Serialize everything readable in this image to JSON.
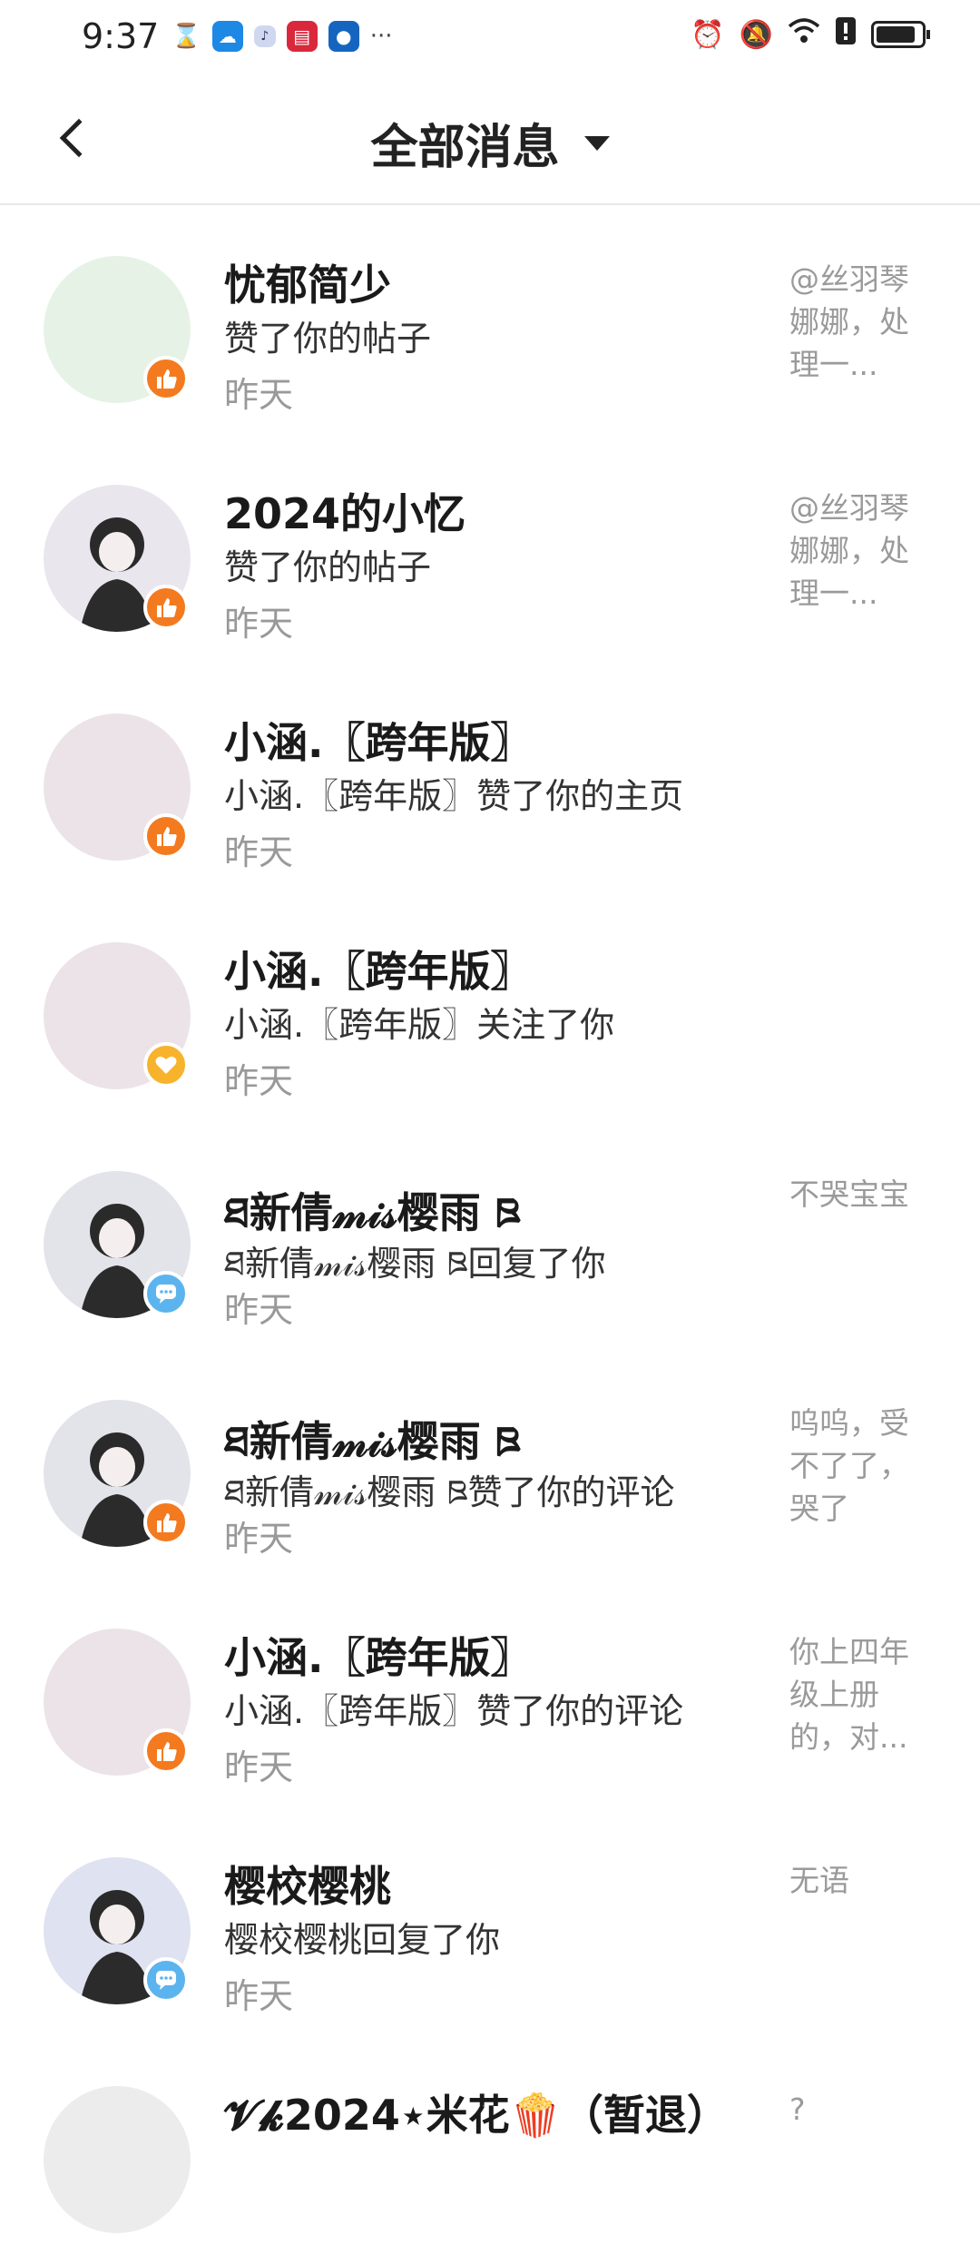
{
  "status_bar": {
    "time": "9:37",
    "dots": "···"
  },
  "header": {
    "title": "全部消息"
  },
  "messages": [
    {
      "name": "忧郁简少",
      "action": "赞了你的帖子",
      "time": "昨天",
      "preview": "@丝羽琴娜娜，处理一...",
      "badge": "like",
      "avatar_color": "#e6f2e6"
    },
    {
      "name": "2024的小忆",
      "action": "赞了你的帖子",
      "time": "昨天",
      "preview": "@丝羽琴娜娜，处理一...",
      "badge": "like",
      "avatar_color": "#e9e6ee"
    },
    {
      "name": "小涵.〖跨年版〗",
      "action": "小涵.〖跨年版〗赞了你的主页",
      "time": "昨天",
      "preview": "",
      "badge": "like",
      "avatar_color": "#ebe3e8"
    },
    {
      "name": "小涵.〖跨年版〗",
      "action": "小涵.〖跨年版〗关注了你",
      "time": "昨天",
      "preview": "",
      "badge": "follow",
      "avatar_color": "#ebe3e8"
    },
    {
      "name": "ཐ新倩𝓂𝒾𝓈樱雨 ཋ",
      "action": "ཐ新倩𝓂𝒾𝓈樱雨 ཋ回复了你",
      "time": "昨天",
      "preview": "不哭宝宝",
      "badge": "reply",
      "avatar_color": "#e3e3ea"
    },
    {
      "name": "ཐ新倩𝓂𝒾𝓈樱雨 ཋ",
      "action": "ཐ新倩𝓂𝒾𝓈樱雨 ཋ赞了你的评论",
      "time": "昨天",
      "preview": "呜呜，受不了了，哭了",
      "badge": "like",
      "avatar_color": "#e3e3ea"
    },
    {
      "name": "小涵.〖跨年版〗",
      "action": "小涵.〖跨年版〗赞了你的评论",
      "time": "昨天",
      "preview": "你上四年级上册的，对...",
      "badge": "like",
      "avatar_color": "#ebe3e8"
    },
    {
      "name": "樱校樱桃",
      "action": "樱校樱桃回复了你",
      "time": "昨天",
      "preview": "无语",
      "badge": "reply",
      "avatar_color": "#dfe2f0"
    },
    {
      "name": "𝓥𝓴2024⋆米花🍿（暂退）",
      "action": "",
      "time": "",
      "preview": "?",
      "badge": "none",
      "avatar_color": "#ececec"
    }
  ],
  "colors": {
    "like_badge": "#f47a1f",
    "follow_badge": "#f7b32b",
    "reply_badge": "#5cb4ee"
  },
  "icons": {
    "back": "back-chevron-icon",
    "dropdown": "caret-down-icon",
    "like": "thumbs-up-icon",
    "follow": "heart-icon",
    "reply": "chat-bubble-icon"
  }
}
